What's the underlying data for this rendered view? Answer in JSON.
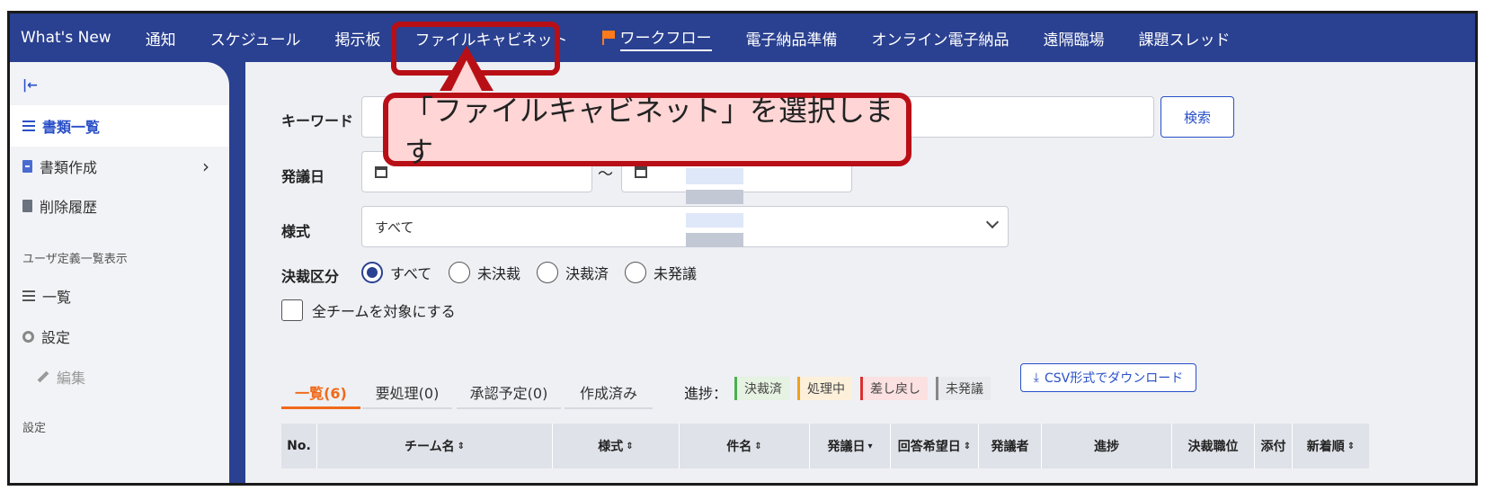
{
  "nav": {
    "items": [
      "What's New",
      "通知",
      "スケジュール",
      "掲示板",
      "ファイルキャビネット",
      "ワークフロー",
      "電子納品準備",
      "オンライン電子納品",
      "遠隔臨場",
      "課題スレッド"
    ]
  },
  "sidebar": {
    "collapse_icon": "collapse-left-icon",
    "items": [
      "書類一覧",
      "書類作成",
      "削除履歴"
    ],
    "section_user": "ユーザ定義一覧表示",
    "user_items": [
      "一覧",
      "設定",
      "編集"
    ],
    "section_settings": "設定"
  },
  "search": {
    "keyword_label": "キーワード",
    "date_label": "発議日",
    "date_sep": "～",
    "style_label": "様式",
    "style_value": "すべて",
    "search_button": "検索",
    "decision_label": "決裁区分",
    "decision_options": [
      "すべて",
      "未決裁",
      "決裁済",
      "未発議"
    ],
    "all_teams": "全チームを対象にする"
  },
  "tabs": [
    "一覧(6)",
    "要処理(0)",
    "承認予定(0)",
    "作成済み"
  ],
  "progress": {
    "label": "進捗：",
    "chips": [
      "決裁済",
      "処理中",
      "差し戻し",
      "未発議"
    ]
  },
  "csv_button": "CSV形式でダウンロード",
  "table": {
    "headers": [
      "No.",
      "チーム名",
      "様式",
      "件名",
      "発議日",
      "回答希望日",
      "発議者",
      "進捗",
      "決裁職位",
      "添付",
      "新着順"
    ]
  },
  "callout": {
    "text": "「ファイルキャビネット」を選択します"
  },
  "colors": {
    "nav_bg": "#2a4090",
    "callout_border": "#b80f17",
    "callout_fill": "#ffd5d5",
    "active_tab": "#f06a1a",
    "link": "#2a50c8"
  }
}
